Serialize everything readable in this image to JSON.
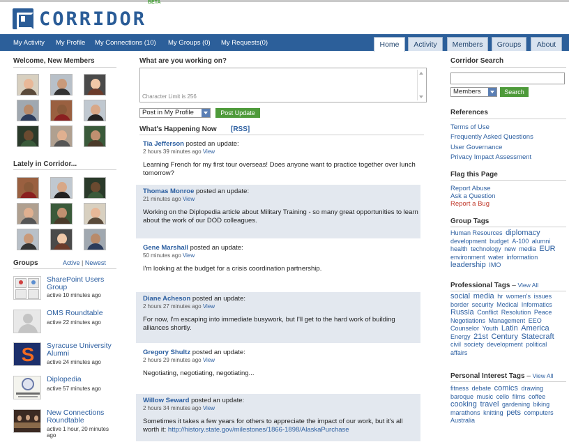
{
  "brand": {
    "name": "CORRIDOR",
    "beta": "BETA"
  },
  "nav": {
    "links": [
      "My Activity",
      "My Profile",
      "My Connections (10)",
      "My Groups (0)",
      "My Requests(0)"
    ],
    "tabs": [
      "Home",
      "Activity",
      "Members",
      "Groups",
      "About"
    ],
    "active_tab": "Home"
  },
  "left": {
    "welcome_title": "Welcome, New Members",
    "lately_title": "Lately in Corridor...",
    "groups_title": "Groups",
    "groups_links": {
      "active": "Active",
      "sep": "|",
      "newest": "Newest"
    },
    "groups": [
      {
        "name": "SharePoint Users Group",
        "meta": "active 10 minutes ago",
        "icon": "sharepoint-icon"
      },
      {
        "name": "OMS Roundtable",
        "meta": "active 22 minutes ago",
        "icon": "default-avatar-icon"
      },
      {
        "name": "Syracuse University Alumni",
        "meta": "active 24 minutes ago",
        "icon": "syracuse-s-icon"
      },
      {
        "name": "Diplopedia",
        "meta": "active 57 minutes ago",
        "icon": "diplopedia-seal-icon"
      },
      {
        "name": "New Connections Roundtable",
        "meta": "active 1 hour, 20 minutes ago",
        "icon": "meeting-photo-icon"
      }
    ]
  },
  "center": {
    "prompt": "What are you working on?",
    "char_limit": "Character Limit is 256",
    "post_target": "Post in My Profile",
    "post_button": "Post Update",
    "feed_title": "What's Happening Now",
    "rss": "[RSS]",
    "posted_text": "posted an update:",
    "view_label": "View",
    "updates": [
      {
        "author": "Tia Jefferson",
        "time": "2 hours 39 minutes ago",
        "message": "Learning French for my first tour overseas! Does anyone want to practice together over lunch tomorrow?",
        "link": ""
      },
      {
        "author": "Thomas Monroe",
        "time": "21 minutes ago",
        "message": "Working on the Diplopedia article about Military Training - so many great opportunities to learn about the work of our DOD colleagues.",
        "link": ""
      },
      {
        "author": "Gene Marshall",
        "time": "50 minutes ago",
        "message": "I'm looking at the budget for a crisis coordination partnership.",
        "link": ""
      },
      {
        "author": "Diane Acheson",
        "time": "2 hours 27 minutes ago",
        "message": "For now, I'm escaping into immediate busywork, but I'll get to the hard work of building alliances shortly.",
        "link": ""
      },
      {
        "author": "Gregory Shultz",
        "time": "2 hours 29 minutes ago",
        "message": "Negotiating, negotiating, negotiating...",
        "link": ""
      },
      {
        "author": "Willow Seward",
        "time": "2 hours 34 minutes ago",
        "message": "Sometimes it takes a few years for others to appreciate the impact of our work, but it's all worth it:",
        "link": "http://history.state.gov/milestones/1866-1898/AlaskaPurchase"
      }
    ]
  },
  "right": {
    "search_title": "Corridor Search",
    "search_placeholder": "",
    "search_scope": "Members",
    "search_button": "Search",
    "references_title": "References",
    "references": [
      "Terms of Use",
      "Frequently Asked Questions",
      "User Governance",
      "Privacy Impact Assessment"
    ],
    "flag_title": "Flag this Page",
    "flag_links": [
      "Report Abuse",
      "Ask a Question",
      "Report a Bug"
    ],
    "group_tags_title": "Group Tags",
    "group_tags": [
      {
        "t": "Human Resources",
        "s": 1
      },
      {
        "t": "diplomacy",
        "s": 2
      },
      {
        "t": "development",
        "s": 1
      },
      {
        "t": "budget",
        "s": 1
      },
      {
        "t": "A-100",
        "s": 1
      },
      {
        "t": "alumni",
        "s": 1
      },
      {
        "t": "health",
        "s": 1
      },
      {
        "t": "technology",
        "s": 1
      },
      {
        "t": "new",
        "s": 1
      },
      {
        "t": "media",
        "s": 1
      },
      {
        "t": "EUR",
        "s": 2
      },
      {
        "t": "environment",
        "s": 1
      },
      {
        "t": "water",
        "s": 1
      },
      {
        "t": "information",
        "s": 1
      },
      {
        "t": "leadership",
        "s": 2
      },
      {
        "t": "IMO",
        "s": 1
      }
    ],
    "pro_tags_title": "Professional Tags",
    "view_all": "View All",
    "dash": "–",
    "pro_tags": [
      {
        "t": "social",
        "s": 2
      },
      {
        "t": "media",
        "s": 2
      },
      {
        "t": "hr",
        "s": 1
      },
      {
        "t": "women's",
        "s": 1
      },
      {
        "t": "issues",
        "s": 1
      },
      {
        "t": "border",
        "s": 1
      },
      {
        "t": "security",
        "s": 1
      },
      {
        "t": "Medical",
        "s": 1
      },
      {
        "t": "Informatics",
        "s": 1
      },
      {
        "t": "Russia",
        "s": 2
      },
      {
        "t": "Conflict",
        "s": 1
      },
      {
        "t": "Resolution",
        "s": 1
      },
      {
        "t": "Peace",
        "s": 1
      },
      {
        "t": "Negotiations",
        "s": 1
      },
      {
        "t": "Management",
        "s": 1
      },
      {
        "t": "EEO",
        "s": 1
      },
      {
        "t": "Counselor",
        "s": 1
      },
      {
        "t": "Youth",
        "s": 1
      },
      {
        "t": "Latin",
        "s": 2
      },
      {
        "t": "America",
        "s": 2
      },
      {
        "t": "Energy",
        "s": 1
      },
      {
        "t": "21st",
        "s": 2
      },
      {
        "t": "Century",
        "s": 2
      },
      {
        "t": "Statecraft",
        "s": 2
      },
      {
        "t": "civil",
        "s": 1
      },
      {
        "t": "society",
        "s": 1
      },
      {
        "t": "development",
        "s": 1
      },
      {
        "t": "political",
        "s": 1
      },
      {
        "t": "affairs",
        "s": 1
      }
    ],
    "personal_tags_title": "Personal Interest Tags",
    "personal_tags": [
      {
        "t": "fitness",
        "s": 1
      },
      {
        "t": "debate",
        "s": 1
      },
      {
        "t": "comics",
        "s": 2
      },
      {
        "t": "drawing",
        "s": 1
      },
      {
        "t": "baroque",
        "s": 1
      },
      {
        "t": "music",
        "s": 1
      },
      {
        "t": "cello",
        "s": 1
      },
      {
        "t": "films",
        "s": 1
      },
      {
        "t": "coffee",
        "s": 1
      },
      {
        "t": "cooking",
        "s": 2
      },
      {
        "t": "travel",
        "s": 2
      },
      {
        "t": "gardening",
        "s": 1
      },
      {
        "t": "biking",
        "s": 1
      },
      {
        "t": "marathons",
        "s": 1
      },
      {
        "t": "knitting",
        "s": 1
      },
      {
        "t": "pets",
        "s": 2
      },
      {
        "t": "computers",
        "s": 1
      },
      {
        "t": "Australia",
        "s": 1
      }
    ]
  },
  "colors": {
    "brand_blue": "#2c5f9a",
    "link_blue": "#2b5ea0",
    "green_button": "#4e9a3a",
    "report_bug_red": "#c0392b"
  }
}
